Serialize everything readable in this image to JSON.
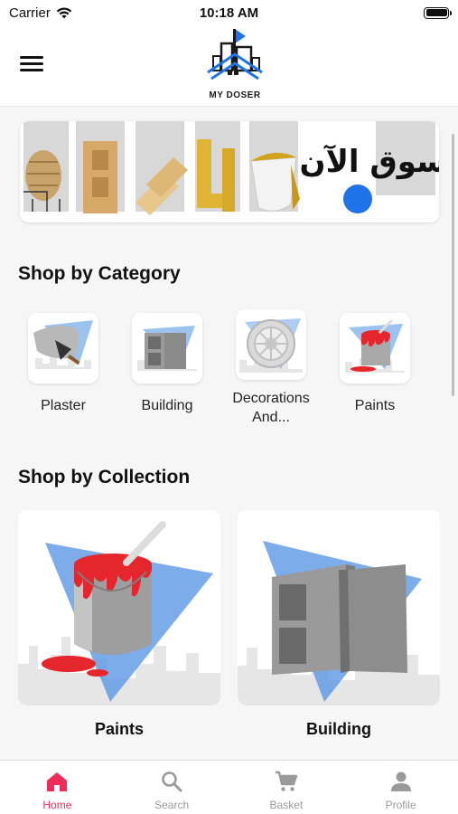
{
  "status_bar": {
    "carrier": "Carrier",
    "time": "10:18 AM"
  },
  "header": {
    "logo_text": "MY DOSER"
  },
  "banner": {
    "text": "تسوق الآن"
  },
  "categories": {
    "title": "Shop by Category",
    "items": [
      {
        "label": "Plaster",
        "icon": "plaster-trowel-icon"
      },
      {
        "label": "Building",
        "icon": "concrete-block-icon"
      },
      {
        "label": "Decorations And...",
        "icon": "ceiling-medallion-icon"
      },
      {
        "label": "Paints",
        "icon": "paint-bucket-icon"
      }
    ]
  },
  "collections": {
    "title": "Shop by Collection",
    "items": [
      {
        "label": "Paints"
      },
      {
        "label": "Building"
      }
    ]
  },
  "tabs": [
    {
      "label": "Home",
      "icon": "home-icon",
      "active": true
    },
    {
      "label": "Search",
      "icon": "search-icon",
      "active": false
    },
    {
      "label": "Basket",
      "icon": "basket-icon",
      "active": false
    },
    {
      "label": "Profile",
      "icon": "profile-icon",
      "active": false
    }
  ],
  "colors": {
    "accent": "#ee2d5a",
    "brand_blue": "#1e73e8",
    "paint_red": "#e5262d"
  }
}
